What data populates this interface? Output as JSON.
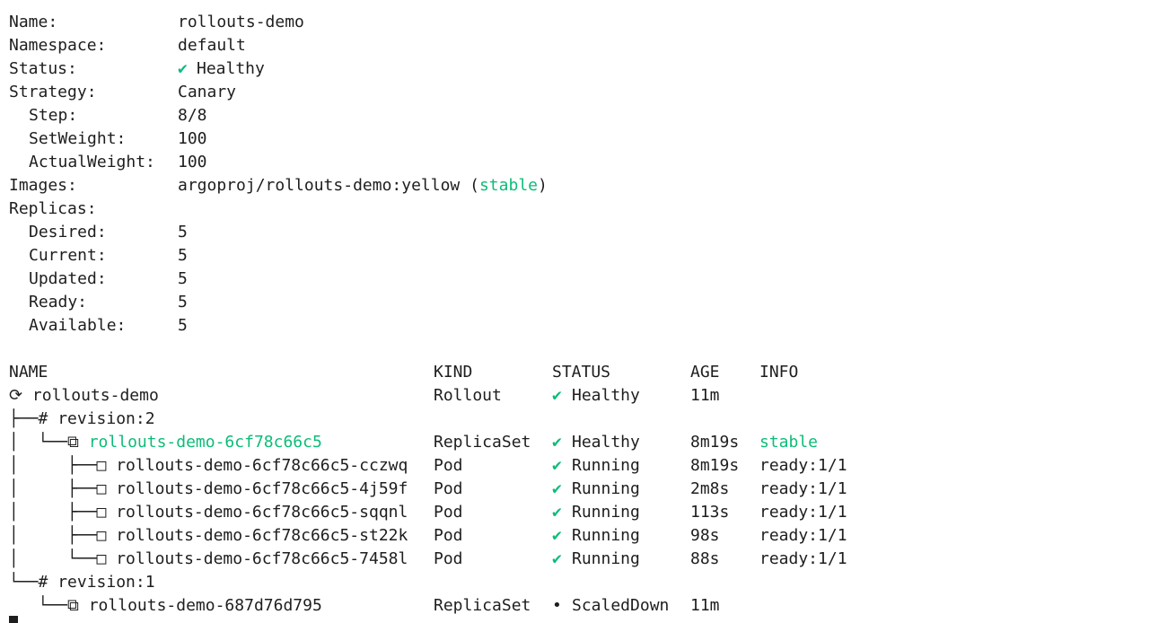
{
  "colors": {
    "green": "#0dbc79",
    "text": "#1e1e1e",
    "background": "#ffffff"
  },
  "info": {
    "name_label": "Name:",
    "name": "rollouts-demo",
    "namespace_label": "Namespace:",
    "namespace": "default",
    "status_label": "Status:",
    "status_icon": "✔",
    "status": "Healthy",
    "strategy_label": "Strategy:",
    "strategy": "Canary",
    "step_label": "Step:",
    "step": "8/8",
    "setweight_label": "SetWeight:",
    "setweight": "100",
    "actualweight_label": "ActualWeight:",
    "actualweight": "100",
    "images_label": "Images:",
    "image": "argoproj/rollouts-demo:yellow",
    "image_open": "(",
    "image_tag": "stable",
    "image_close": ")",
    "replicas_label": "Replicas:",
    "desired_label": "Desired:",
    "desired": "5",
    "current_label": "Current:",
    "current": "5",
    "updated_label": "Updated:",
    "updated": "5",
    "ready_label": "Ready:",
    "ready": "5",
    "available_label": "Available:",
    "available": "5"
  },
  "table": {
    "headers": {
      "name": "NAME",
      "kind": "KIND",
      "status": "STATUS",
      "age": "AGE",
      "info": "INFO"
    },
    "rows": [
      {
        "prefix": "⟳ ",
        "name": "rollouts-demo",
        "kind": "Rollout",
        "status_icon": "✔",
        "status": "Healthy",
        "age": "11m",
        "info": ""
      },
      {
        "prefix": "├──# ",
        "name": "revision:2",
        "kind": "",
        "status_icon": "",
        "status": "",
        "age": "",
        "info": ""
      },
      {
        "prefix": "│  └──⧉ ",
        "name": "rollouts-demo-6cf78c66c5",
        "kind": "ReplicaSet",
        "status_icon": "✔",
        "status": "Healthy",
        "age": "8m19s",
        "info": "stable"
      },
      {
        "prefix": "│     ├──□ ",
        "name": "rollouts-demo-6cf78c66c5-cczwq",
        "kind": "Pod",
        "status_icon": "✔",
        "status": "Running",
        "age": "8m19s",
        "info": "ready:1/1"
      },
      {
        "prefix": "│     ├──□ ",
        "name": "rollouts-demo-6cf78c66c5-4j59f",
        "kind": "Pod",
        "status_icon": "✔",
        "status": "Running",
        "age": "2m8s",
        "info": "ready:1/1"
      },
      {
        "prefix": "│     ├──□ ",
        "name": "rollouts-demo-6cf78c66c5-sqqnl",
        "kind": "Pod",
        "status_icon": "✔",
        "status": "Running",
        "age": "113s",
        "info": "ready:1/1"
      },
      {
        "prefix": "│     ├──□ ",
        "name": "rollouts-demo-6cf78c66c5-st22k",
        "kind": "Pod",
        "status_icon": "✔",
        "status": "Running",
        "age": "98s",
        "info": "ready:1/1"
      },
      {
        "prefix": "│     └──□ ",
        "name": "rollouts-demo-6cf78c66c5-7458l",
        "kind": "Pod",
        "status_icon": "✔",
        "status": "Running",
        "age": "88s",
        "info": "ready:1/1"
      },
      {
        "prefix": "└──# ",
        "name": "revision:1",
        "kind": "",
        "status_icon": "",
        "status": "",
        "age": "",
        "info": ""
      },
      {
        "prefix": "   └──⧉ ",
        "name": "rollouts-demo-687d76d795",
        "kind": "ReplicaSet",
        "status_icon": "•",
        "status": "ScaledDown",
        "age": "11m",
        "info": ""
      }
    ]
  }
}
